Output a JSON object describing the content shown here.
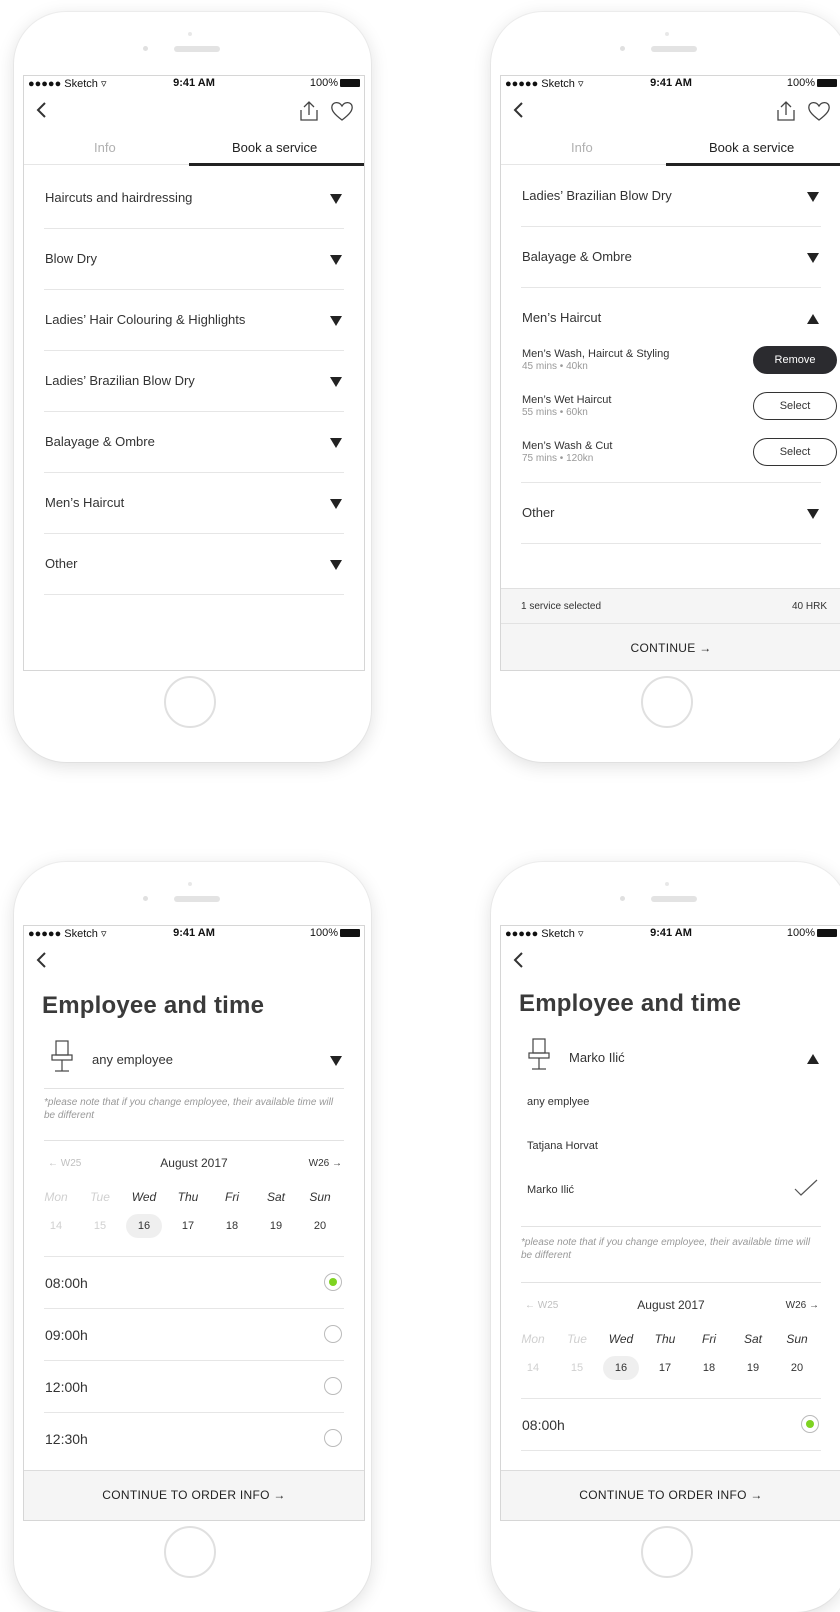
{
  "status": {
    "carrier": "●●●●● Sketch ▿",
    "time": "9:41 AM",
    "battery": "100%"
  },
  "screen1": {
    "tabs": {
      "info": "Info",
      "book": "Book a service"
    },
    "categories": [
      "Haircuts and hairdressing",
      "Blow Dry",
      "Ladies’ Hair Colouring & Highlights",
      "Ladies’ Brazilian Blow Dry",
      "Balayage & Ombre",
      "Men’s Haircut",
      "Other"
    ]
  },
  "screen2": {
    "tabs": {
      "info": "Info",
      "book": "Book a service"
    },
    "categories": [
      "Ladies’ Brazilian Blow Dry",
      "Balayage & Ombre",
      "Men’s Haircut",
      "Other"
    ],
    "services": [
      {
        "name": "Men’s Wash, Haircut & Styling",
        "meta": "45 mins • 40kn",
        "action": "Remove",
        "selected": true
      },
      {
        "name": "Men’s Wet Haircut",
        "meta": "55 mins • 60kn",
        "action": "Select",
        "selected": false
      },
      {
        "name": "Men’s Wash & Cut",
        "meta": "75 mins • 120kn",
        "action": "Select",
        "selected": false
      }
    ],
    "summary": {
      "count": "1 service selected",
      "total": "40 HRK",
      "continue": "CONTINUE →"
    }
  },
  "screen3": {
    "title": "Employee and time",
    "employee": "any employee",
    "note": "*please note that if you change employee, their available time will be different",
    "week": {
      "prev": "← W25",
      "month": "August 2017",
      "next": "W26 →"
    },
    "days": [
      "Mon",
      "Tue",
      "Wed",
      "Thu",
      "Fri",
      "Sat",
      "Sun"
    ],
    "dates": [
      "14",
      "15",
      "16",
      "17",
      "18",
      "19",
      "20"
    ],
    "slots": [
      "08:00h",
      "09:00h",
      "12:00h",
      "12:30h"
    ],
    "continue": "CONTINUE TO ORDER INFO →"
  },
  "screen4": {
    "title": "Employee and time",
    "employee": "Marko Ilić",
    "options": [
      "any emplyee",
      "Tatjana Horvat",
      "Marko Ilić"
    ],
    "note": "*please note that if you change employee, their available time will be different",
    "week": {
      "prev": "← W25",
      "month": "August 2017",
      "next": "W26 →"
    },
    "days": [
      "Mon",
      "Tue",
      "Wed",
      "Thu",
      "Fri",
      "Sat",
      "Sun"
    ],
    "dates": [
      "14",
      "15",
      "16",
      "17",
      "18",
      "19",
      "20"
    ],
    "slots": [
      "08:00h"
    ],
    "continue": "CONTINUE TO ORDER INFO →"
  },
  "colors": {
    "accent_green": "#7ed321",
    "dark_button": "#2b2b2f",
    "footer_bg": "#f5f5f5"
  }
}
